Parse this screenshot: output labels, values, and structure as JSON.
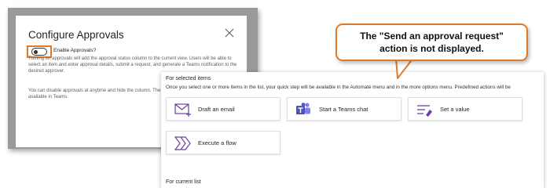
{
  "dialog": {
    "title": "Configure Approvals",
    "enable_label": "Enable Approvals?",
    "paragraph1": "Turning on approvals will add the approval status column to the current view. Users will be able to select an item and enter approval details, submit a request, and generate a Teams notification to the desired approver.",
    "paragraph2": "You can disable approvals at anytime and hide the column. The details of approvals will still be available in Teams."
  },
  "callout": {
    "line1": "The \"Send an approval request\"",
    "line2": "action is not displayed.",
    "accent_color": "#e07a28"
  },
  "panel": {
    "section_selected": "For selected items",
    "description": "Once you select one or more items in the list, your quick step will be available in the Automate menu and in the more options menu. Predefined actions will be",
    "cards": [
      {
        "label": "Draft an email",
        "icon": "mail-icon"
      },
      {
        "label": "Start a Teams chat",
        "icon": "teams-icon"
      },
      {
        "label": "Set a value",
        "icon": "set-value-icon"
      },
      {
        "label": "Execute a flow",
        "icon": "flow-icon"
      }
    ],
    "section_current": "For current list"
  }
}
